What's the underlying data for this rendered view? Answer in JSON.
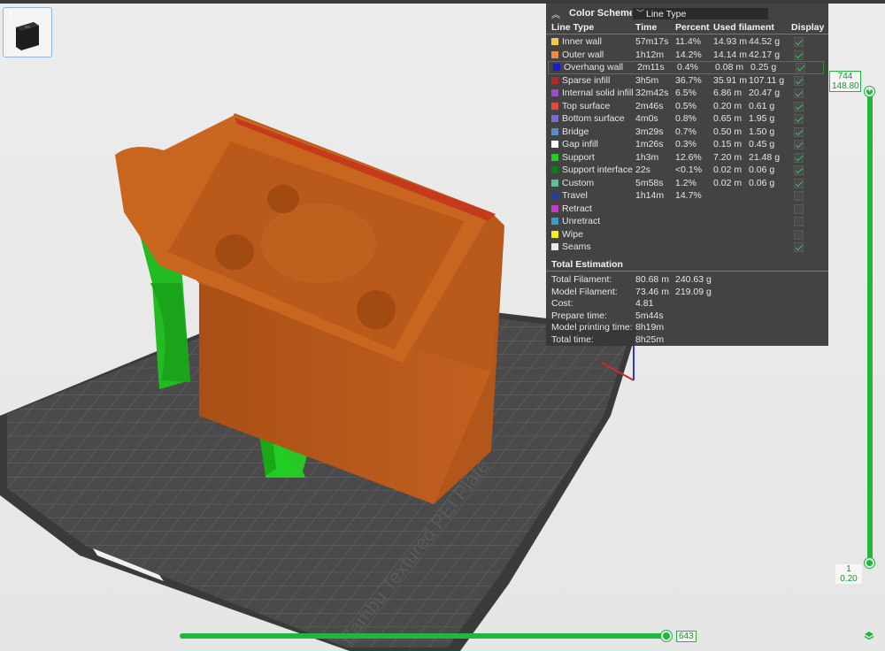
{
  "plate": {
    "thumbnail_index": "1",
    "plate_text": "Bambu Textured PEI Plate"
  },
  "color_scheme": {
    "title": "Color Scheme",
    "selected": "Line Type",
    "headers": {
      "type": "Line Type",
      "time": "Time",
      "percent": "Percent",
      "used": "Used filament",
      "display": "Display"
    },
    "rows": [
      {
        "name": "Inner wall",
        "color": "#f2c94c",
        "time": "57m17s",
        "percent": "11.4%",
        "length": "14.93 m",
        "weight": "44.52 g",
        "display": true
      },
      {
        "name": "Outer wall",
        "color": "#f08a3c",
        "time": "1h12m",
        "percent": "14.2%",
        "length": "14.14 m",
        "weight": "42.17 g",
        "display": true
      },
      {
        "name": "Overhang wall",
        "color": "#1a1acc",
        "time": "2m11s",
        "percent": "0.4%",
        "length": "0.08 m",
        "weight": "0.25 g",
        "display": true,
        "highlight": true
      },
      {
        "name": "Sparse infill",
        "color": "#b02a2a",
        "time": "3h5m",
        "percent": "36.7%",
        "length": "35.91 m",
        "weight": "107.11 g",
        "display": true
      },
      {
        "name": "Internal solid infill",
        "color": "#9a4fc2",
        "time": "32m42s",
        "percent": "6.5%",
        "length": "6.86 m",
        "weight": "20.47 g",
        "display": true
      },
      {
        "name": "Top surface",
        "color": "#e04a3c",
        "time": "2m46s",
        "percent": "0.5%",
        "length": "0.20 m",
        "weight": "0.61 g",
        "display": true
      },
      {
        "name": "Bottom surface",
        "color": "#7a6ad8",
        "time": "4m0s",
        "percent": "0.8%",
        "length": "0.65 m",
        "weight": "1.95 g",
        "display": true
      },
      {
        "name": "Bridge",
        "color": "#5a8ac8",
        "time": "3m29s",
        "percent": "0.7%",
        "length": "0.50 m",
        "weight": "1.50 g",
        "display": true
      },
      {
        "name": "Gap infill",
        "color": "#ffffff",
        "time": "1m26s",
        "percent": "0.3%",
        "length": "0.15 m",
        "weight": "0.45 g",
        "display": true
      },
      {
        "name": "Support",
        "color": "#22cc22",
        "time": "1h3m",
        "percent": "12.6%",
        "length": "7.20 m",
        "weight": "21.48 g",
        "display": true
      },
      {
        "name": "Support interface",
        "color": "#0f7a1a",
        "time": "22s",
        "percent": "<0.1%",
        "length": "0.02 m",
        "weight": "0.06 g",
        "display": true
      },
      {
        "name": "Custom",
        "color": "#5ec09a",
        "time": "5m58s",
        "percent": "1.2%",
        "length": "0.02 m",
        "weight": "0.06 g",
        "display": true
      },
      {
        "name": "Travel",
        "color": "#2a3a9a",
        "time": "1h14m",
        "percent": "14.7%",
        "length": "",
        "weight": "",
        "display": false
      },
      {
        "name": "Retract",
        "color": "#c83ac8",
        "time": "",
        "percent": "",
        "length": "",
        "weight": "",
        "display": false
      },
      {
        "name": "Unretract",
        "color": "#3a9ac8",
        "time": "",
        "percent": "",
        "length": "",
        "weight": "",
        "display": false
      },
      {
        "name": "Wipe",
        "color": "#f2f21a",
        "time": "",
        "percent": "",
        "length": "",
        "weight": "",
        "display": false
      },
      {
        "name": "Seams",
        "color": "#e8e8e8",
        "time": "",
        "percent": "",
        "length": "",
        "weight": "",
        "display": true
      }
    ]
  },
  "estimation": {
    "title": "Total Estimation",
    "rows": [
      {
        "label": "Total Filament:",
        "v1": "80.68 m",
        "v2": "240.63 g"
      },
      {
        "label": "Model Filament:",
        "v1": "73.46 m",
        "v2": "219.09 g"
      },
      {
        "label": "Cost:",
        "v1": "4.81",
        "v2": ""
      },
      {
        "label": "Prepare time:",
        "v1": "5m44s",
        "v2": ""
      },
      {
        "label": "Model printing time:",
        "v1": "8h19m",
        "v2": ""
      },
      {
        "label": "Total time:",
        "v1": "8h25m",
        "v2": ""
      }
    ]
  },
  "layer_slider": {
    "top_layer": "744",
    "top_height": "148.80",
    "bottom_layer": "1",
    "bottom_height": "0.20"
  },
  "move_slider": {
    "value": "643"
  },
  "colors": {
    "accent": "#1fb73c",
    "model": "#c2601f",
    "support": "#22cc22",
    "plate": "#4d4d4d"
  }
}
